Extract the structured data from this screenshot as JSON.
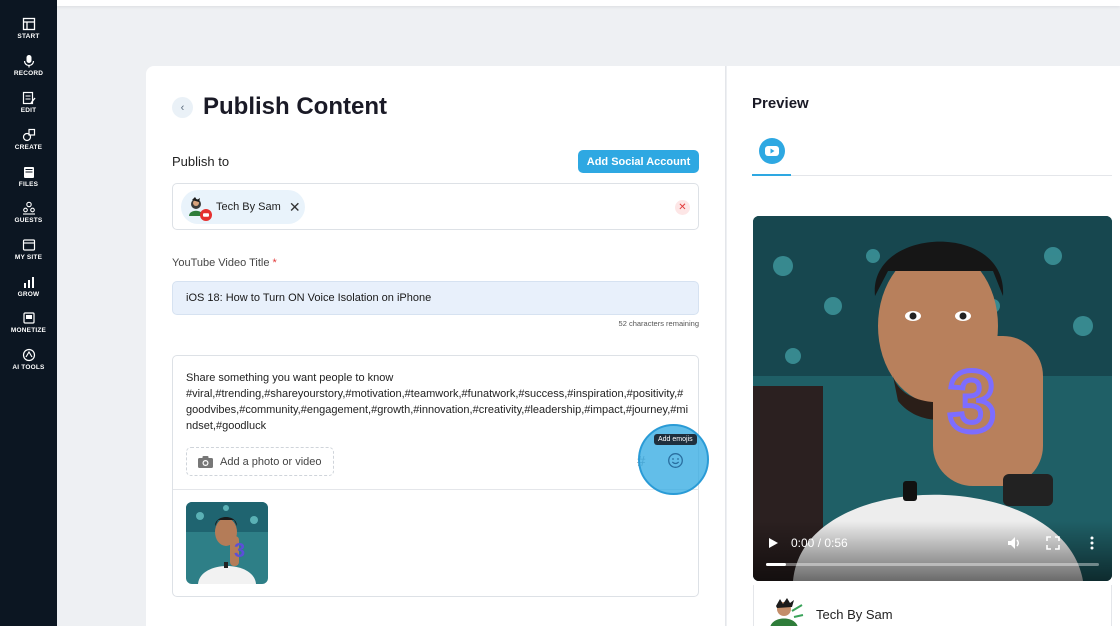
{
  "sidebar": {
    "items": [
      {
        "label": "START",
        "icon": "start-icon"
      },
      {
        "label": "RECORD",
        "icon": "microphone-icon"
      },
      {
        "label": "EDIT",
        "icon": "edit-icon"
      },
      {
        "label": "CREATE",
        "icon": "create-icon"
      },
      {
        "label": "FILES",
        "icon": "files-icon"
      },
      {
        "label": "GUESTS",
        "icon": "guests-icon"
      },
      {
        "label": "MY SITE",
        "icon": "site-icon"
      },
      {
        "label": "GROW",
        "icon": "grow-icon"
      },
      {
        "label": "MONETIZE",
        "icon": "monetize-icon"
      },
      {
        "label": "AI TOOLS",
        "icon": "ai-tools-icon"
      }
    ]
  },
  "page": {
    "title": "Publish Content",
    "back_icon": "chevron-left-icon"
  },
  "publish_to": {
    "label": "Publish to",
    "add_account_label": "Add Social Account",
    "accounts": [
      {
        "name": "Tech By Sam",
        "platform": "youtube"
      }
    ],
    "remove_icon": "close-icon"
  },
  "video_title": {
    "label": "YouTube Video Title",
    "required_mark": "*",
    "value": "iOS 18: How to Turn ON Voice Isolation on iPhone",
    "chars_remaining": "52 characters remaining"
  },
  "description": {
    "text": "Share something you want people to know\n#viral,#trending,#shareyourstory,#motivation,#teamwork,#funatwork,#success,#inspiration,#positivity,#goodvibes,#community,#engagement,#growth,#innovation,#creativity,#leadership,#impact,#journey,#mindset,#goodluck",
    "add_media_label": "Add a photo or video",
    "emoji_tooltip": "Add emojis",
    "hashtag_icon": "hashtag-icon",
    "emoji_icon": "smiley-icon"
  },
  "preview": {
    "title": "Preview",
    "tab_icon": "youtube-icon",
    "video_time": "0:00 / 0:56",
    "progress": 0.06,
    "account_name": "Tech By Sam"
  },
  "colors": {
    "accent": "#2ea8e2",
    "sidebar_bg": "#0c1622",
    "danger": "#e23b3b"
  }
}
